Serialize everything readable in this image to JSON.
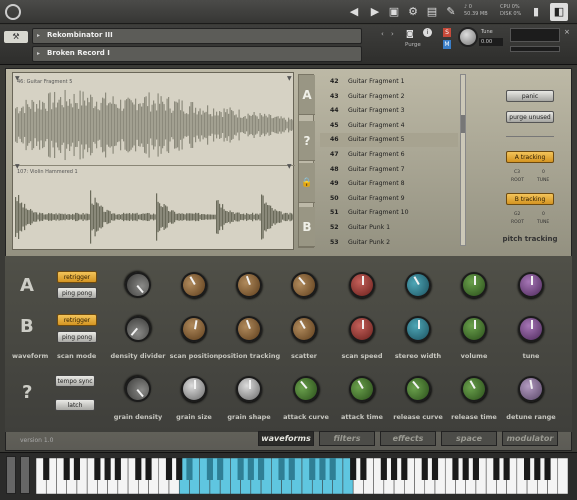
{
  "topbar": {
    "cpu_label": "CPU 0%",
    "disk_label": "DISK 0%",
    "voices": "0",
    "memory": "50.39 MB",
    "midi_label": "MIDI"
  },
  "header": {
    "instrument_name": "Rekombinator III",
    "snapshot_name": "Broken Record I",
    "purge_label": "Purge",
    "tune_label": "Tune",
    "tune_value": "0.00",
    "solo_label": "S",
    "mute_label": "M"
  },
  "waveview": {
    "slot_a_label": "46: Guitar Fragment 5",
    "slot_b_label": "107: Violin Hammered 1"
  },
  "ab_selector": [
    "A",
    "?",
    "🔒",
    "B"
  ],
  "sample_list": [
    {
      "n": "42",
      "t": "Guitar Fragment 1"
    },
    {
      "n": "43",
      "t": "Guitar Fragment 2"
    },
    {
      "n": "44",
      "t": "Guitar Fragment 3"
    },
    {
      "n": "45",
      "t": "Guitar Fragment 4"
    },
    {
      "n": "46",
      "t": "Guitar Fragment 5"
    },
    {
      "n": "47",
      "t": "Guitar Fragment 6"
    },
    {
      "n": "48",
      "t": "Guitar Fragment 7"
    },
    {
      "n": "49",
      "t": "Guitar Fragment 8"
    },
    {
      "n": "50",
      "t": "Guitar Fragment 9"
    },
    {
      "n": "51",
      "t": "Guitar Fragment 10"
    },
    {
      "n": "52",
      "t": "Guitar Punk 1"
    },
    {
      "n": "53",
      "t": "Guitar Punk 2"
    }
  ],
  "selected_index": 4,
  "right_panel": {
    "panic": "panic",
    "purge_unused": "purge unused",
    "a_tracking": "A tracking",
    "b_tracking": "B tracking",
    "a_root_val": "C3",
    "a_tune_val": "0",
    "b_root_val": "G2",
    "b_tune_val": "0",
    "root_label": "ROOT",
    "tune_label": "TUNE",
    "pitch_tracking": "pitch tracking"
  },
  "row_labels": {
    "a": "A",
    "b": "B",
    "waveform": "waveform",
    "q": "?"
  },
  "buttons": {
    "retrigger": "retrigger",
    "ping_pong": "ping pong",
    "scan_mode": "scan mode",
    "tempo_sync": "tempo sync",
    "latch": "latch"
  },
  "knob_labels": {
    "density_divider": "density divider",
    "scan_position": "scan position",
    "position_tracking": "position tracking",
    "scatter": "scatter",
    "scan_speed": "scan speed",
    "stereo_width": "stereo width",
    "volume": "volume",
    "tune": "tune",
    "grain_density": "grain density",
    "grain_size": "grain size",
    "grain_shape": "grain shape",
    "attack_curve": "attack curve",
    "attack_time": "attack time",
    "release_curve": "release curve",
    "release_time": "release time",
    "detune_range": "detune range"
  },
  "tabs": [
    "waveforms",
    "filters",
    "effects",
    "space",
    "modulator"
  ],
  "active_tab": "waveforms",
  "version": "version 1.0",
  "colors": {
    "accent_yellow": "#e8ad3c",
    "keyboard_highlight": "#5fc6e0"
  }
}
